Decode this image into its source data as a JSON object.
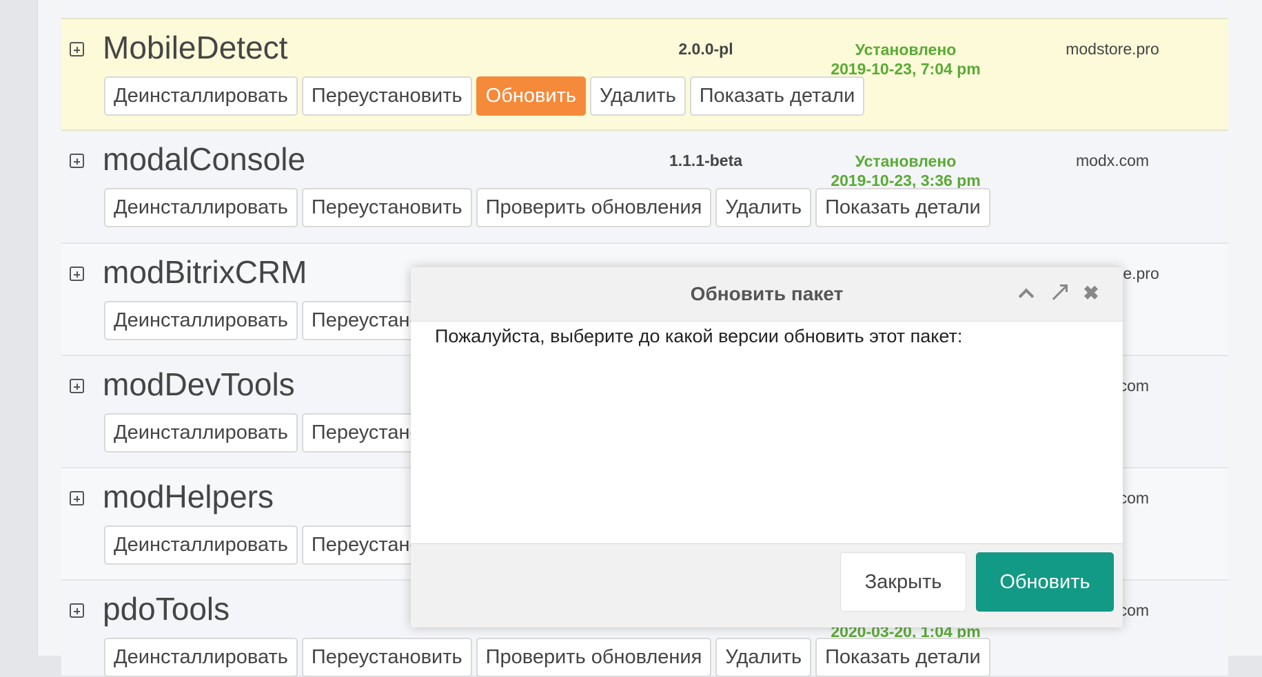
{
  "packages": [
    {
      "name": "MobileDetect",
      "version": "2.0.0-pl",
      "status": "Установлено",
      "installed": "2019-10-23, 7:04 pm",
      "provider": "modstore.pro",
      "buttons": [
        "Деинсталлировать",
        "Переустановить",
        "Обновить",
        "Удалить",
        "Показать детали"
      ]
    },
    {
      "name": "modalConsole",
      "version": "1.1.1-beta",
      "status": "Установлено",
      "installed": "2019-10-23, 3:36 pm",
      "provider": "modx.com",
      "buttons": [
        "Деинсталлировать",
        "Переустановить",
        "Проверить обновления",
        "Удалить",
        "Показать детали"
      ]
    },
    {
      "name": "modBitrixCRM",
      "provider": "modstore.pro",
      "buttons": [
        "Деинсталлировать",
        "Переустановить"
      ]
    },
    {
      "name": "modDevTools",
      "provider": "modx.com",
      "buttons": [
        "Деинсталлировать",
        "Переустановить"
      ]
    },
    {
      "name": "modHelpers",
      "provider": "modx.com",
      "buttons": [
        "Деинсталлировать",
        "Переустановить"
      ]
    },
    {
      "name": "pdoTools",
      "installed": "2020-03-20, 1:04 pm",
      "provider": "modx.com",
      "buttons": [
        "Деинсталлировать",
        "Переустановить",
        "Проверить обновления",
        "Удалить",
        "Показать детали"
      ]
    }
  ],
  "dialog": {
    "title": "Обновить пакет",
    "message": "Пожалуйста, выберите до какой версии обновить этот пакет:",
    "close_label": "Закрыть",
    "update_label": "Обновить"
  },
  "colors": {
    "accent_orange": "#f58a3a",
    "accent_teal": "#139a86",
    "status_green": "#5aaa35",
    "highlight_row": "#fcfad9"
  }
}
